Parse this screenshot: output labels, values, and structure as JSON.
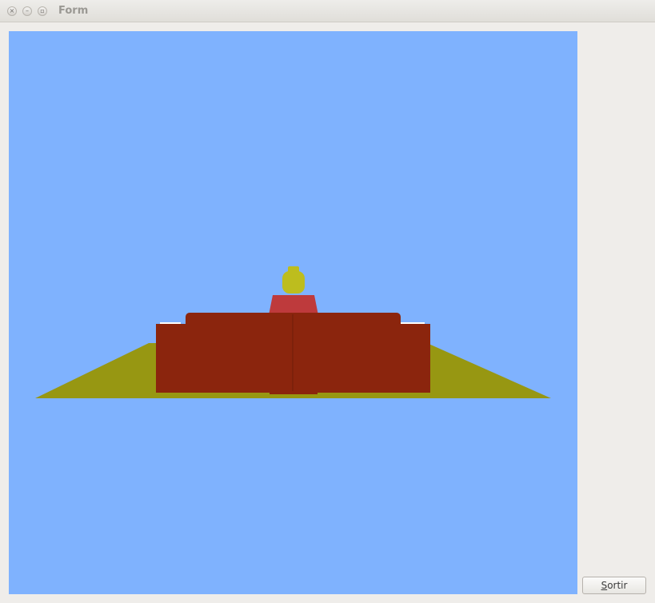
{
  "window": {
    "title": "Form",
    "controls": {
      "close_glyph": "×",
      "minimize_glyph": "–",
      "maximize_glyph": "▫"
    }
  },
  "scene": {
    "sky_color": "#7fb2fe",
    "ground_color": "#979712",
    "couch_color": "#8b250d",
    "shirt_color": "#be3a3c",
    "head_color": "#bdbd1e"
  },
  "buttons": {
    "quit_label_mnemonic": "S",
    "quit_label_rest": "ortir"
  }
}
